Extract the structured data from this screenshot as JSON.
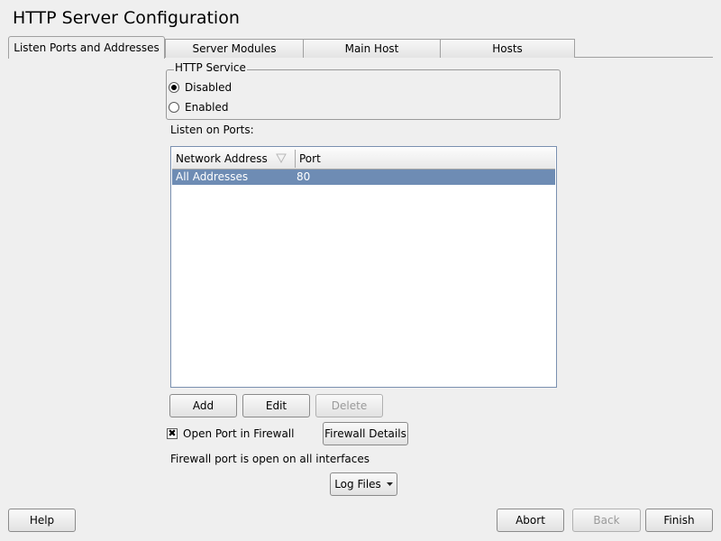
{
  "window": {
    "title": "HTTP Server Configuration"
  },
  "tabs": [
    {
      "label": "Listen Ports and Addresses",
      "active": true
    },
    {
      "label": "Server Modules",
      "active": false
    },
    {
      "label": "Main Host",
      "active": false
    },
    {
      "label": "Hosts",
      "active": false
    }
  ],
  "http_service": {
    "legend": "HTTP Service",
    "options": [
      {
        "label": "Disabled",
        "selected": true
      },
      {
        "label": "Enabled",
        "selected": false
      }
    ]
  },
  "ports": {
    "label": "Listen on Ports:",
    "columns": [
      "Network Address",
      "Port"
    ],
    "sort_icon": "sort-triangle-icon",
    "rows": [
      {
        "address": "All Addresses",
        "port": "80",
        "selected": true
      }
    ],
    "selection_color": "#6e8cb4"
  },
  "table_buttons": {
    "add": "Add",
    "edit": "Edit",
    "delete": "Delete"
  },
  "firewall": {
    "checkbox_label": "Open Port in Firewall",
    "checked": true,
    "details_button": "Firewall Details",
    "status": "Firewall port is open on all interfaces"
  },
  "log_files": {
    "label": "Log Files",
    "icon": "dropdown-arrow-icon"
  },
  "footer": {
    "help": "Help",
    "abort": "Abort",
    "back": "Back",
    "finish": "Finish"
  }
}
